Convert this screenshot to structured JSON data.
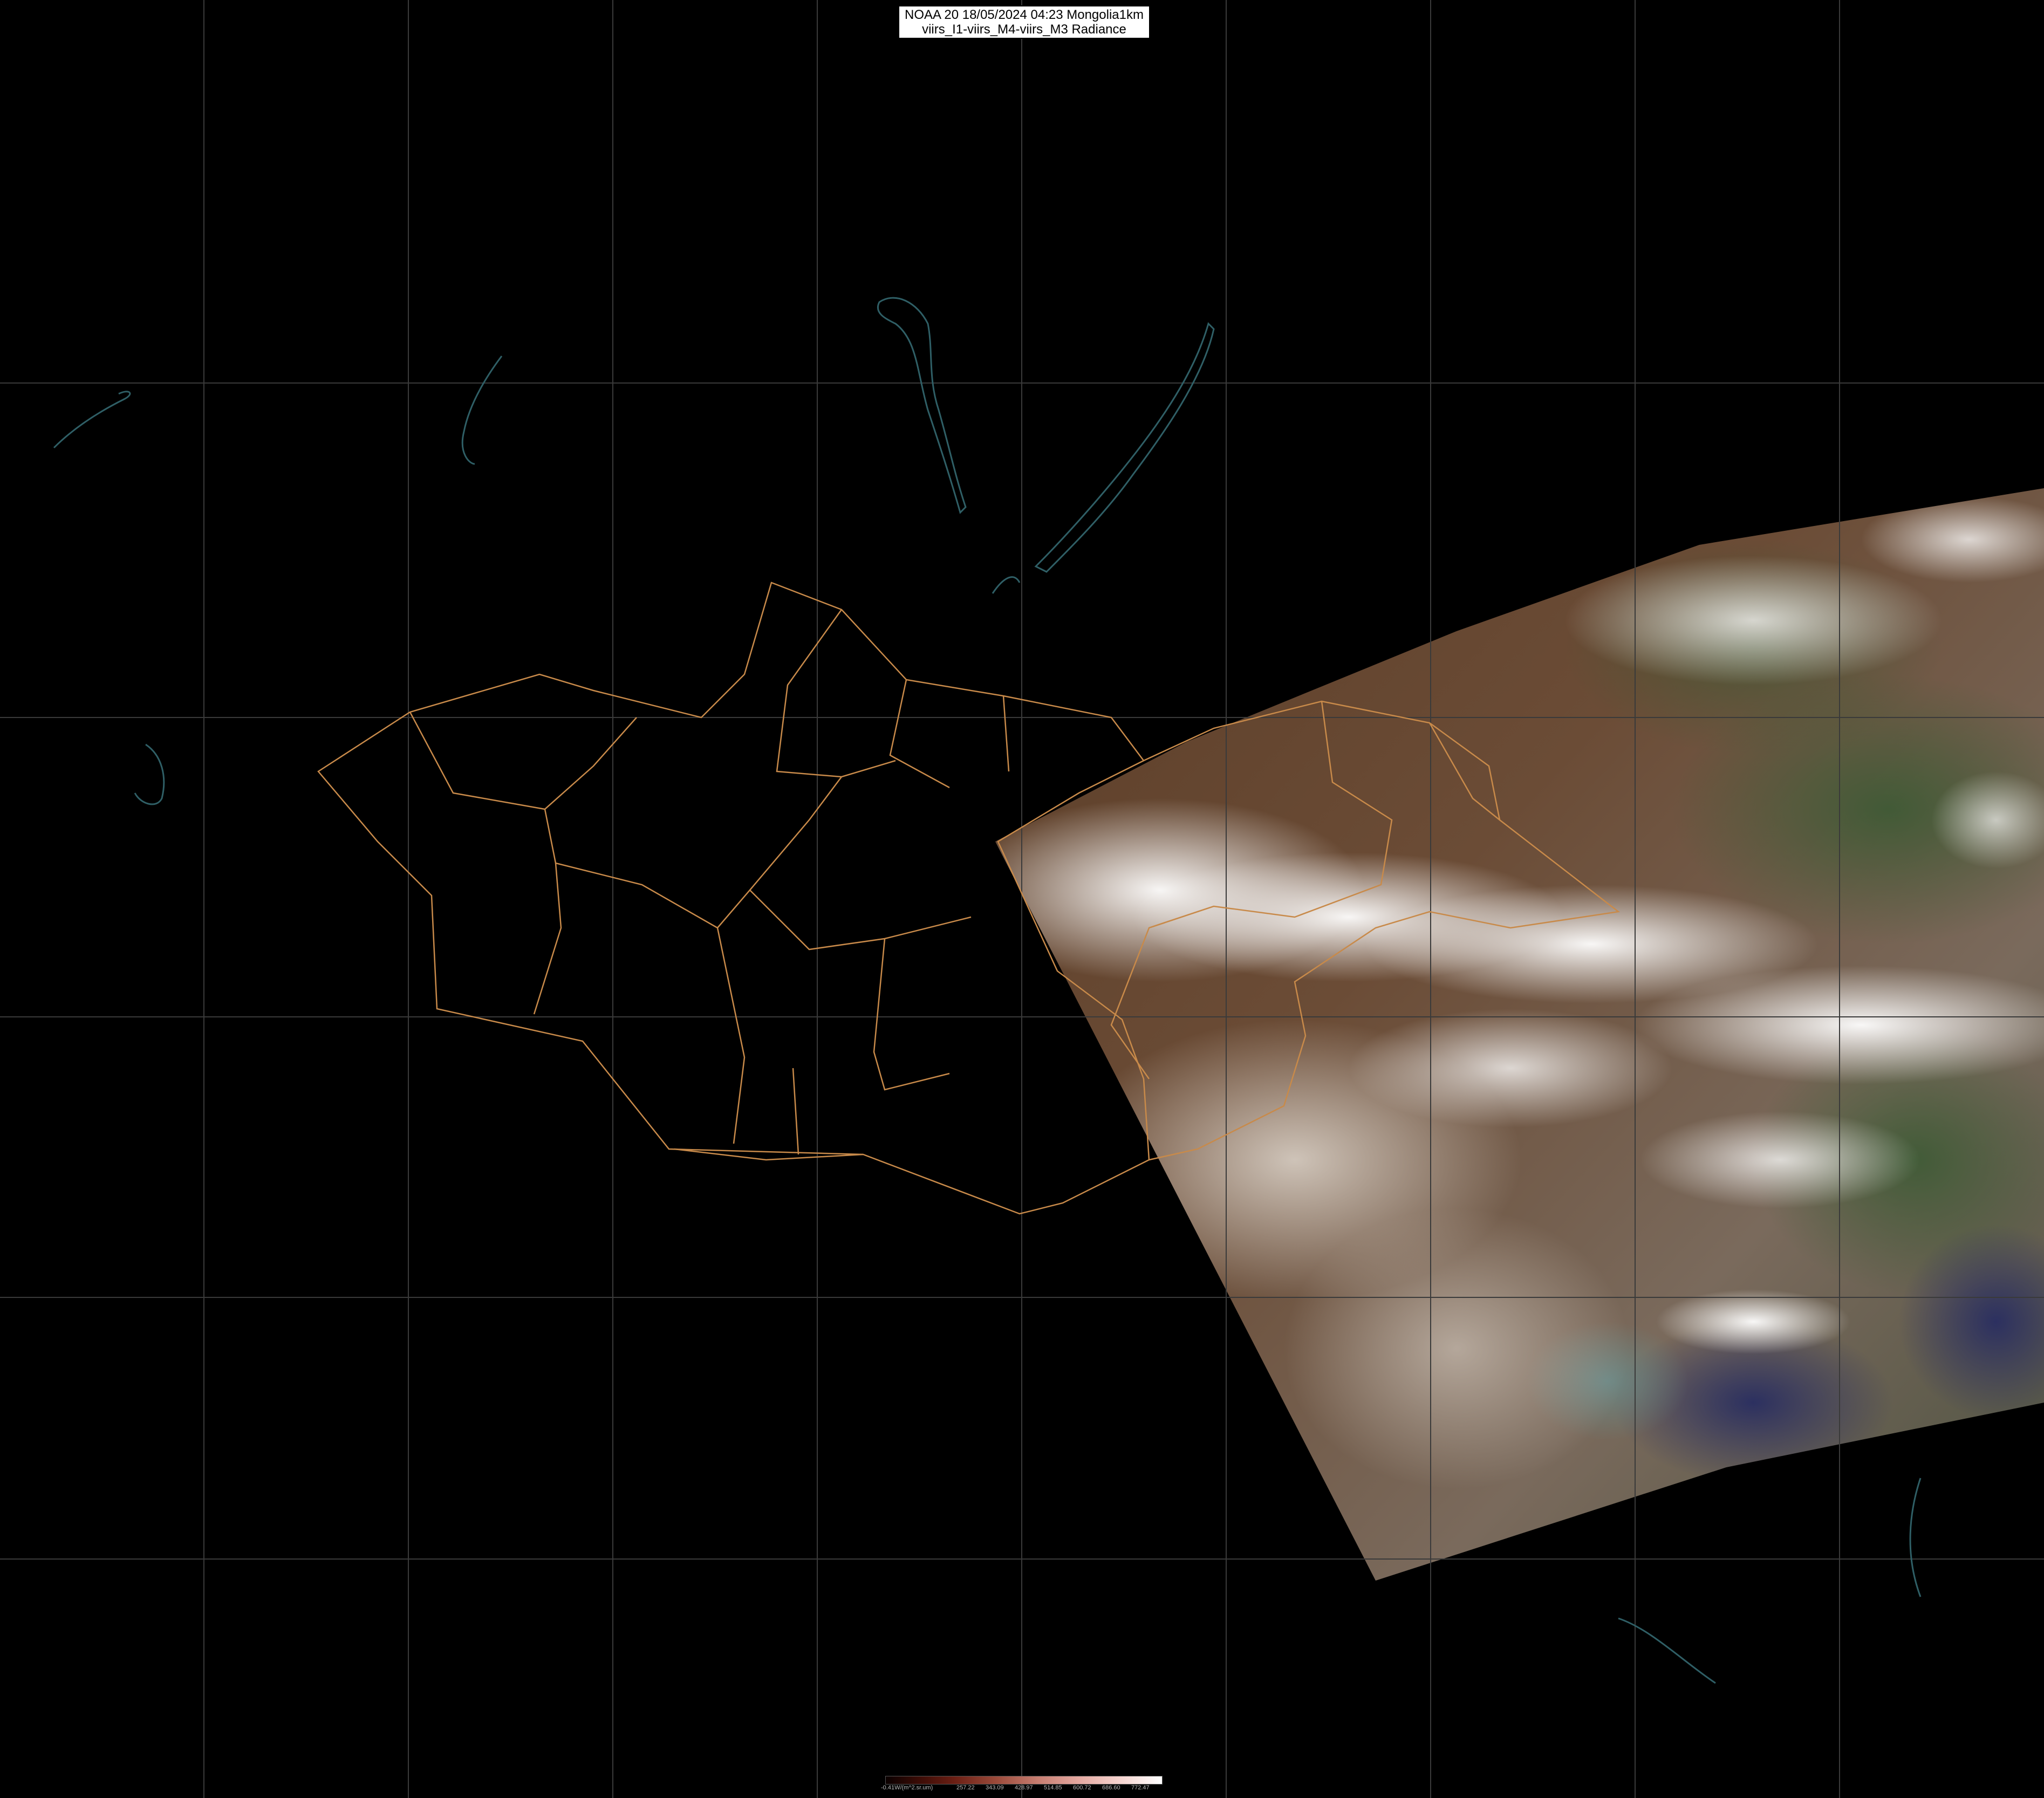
{
  "title": {
    "line1": "NOAA 20 18/05/2024 04:23 Mongolia1km",
    "line2": "viirs_I1-viirs_M4-viirs_M3 Radiance"
  },
  "legend": {
    "unit_label": "-0.41W/(m^2.sr.um)",
    "ticks": [
      "257.22",
      "343.09",
      "428.97",
      "514.85",
      "600.72",
      "686.60",
      "772.47"
    ]
  },
  "colors": {
    "background": "#000000",
    "graticule": "#3a3a3a",
    "borders": "#c88a4a",
    "coastline": "#2f5f66",
    "cloud": "#f2f2f2",
    "land_brown": "#6b4a32",
    "sea": "#2c2f55"
  }
}
